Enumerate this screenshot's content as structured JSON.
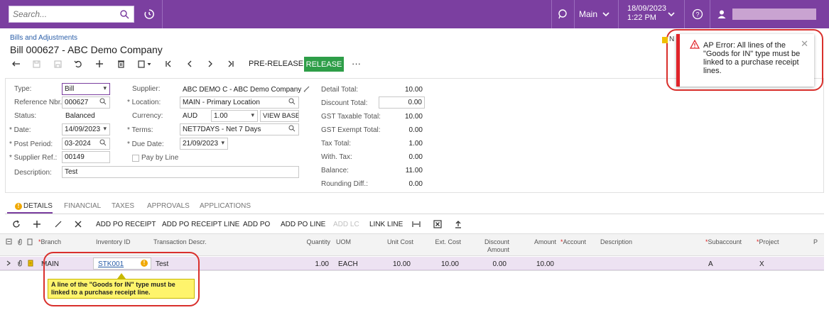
{
  "topbar": {
    "search_placeholder": "Search...",
    "company": "Main",
    "date": "18/09/2023",
    "time": "1:22 PM"
  },
  "header": {
    "breadcrumb": "Bills and Adjustments",
    "title": "Bill 000627 - ABC Demo Company"
  },
  "toolbar": {
    "pre_release": "PRE-RELEASE",
    "release": "RELEASE",
    "more": "···"
  },
  "form": {
    "type_label": "Type:",
    "type_value": "Bill",
    "refnbr_label": "Reference Nbr.:",
    "refnbr_value": "000627",
    "status_label": "Status:",
    "status_value": "Balanced",
    "date_label": "Date:",
    "date_value": "14/09/2023",
    "postperiod_label": "Post Period:",
    "postperiod_value": "03-2024",
    "supref_label": "Supplier Ref.:",
    "supref_value": "00149",
    "desc_label": "Description:",
    "desc_value": "Test",
    "supplier_label": "Supplier:",
    "supplier_value": "ABC DEMO C - ABC Demo Company",
    "location_label": "Location:",
    "location_value": "MAIN - Primary Location",
    "currency_label": "Currency:",
    "currency_code": "AUD",
    "currency_rate": "1.00",
    "view_base": "VIEW BASE",
    "terms_label": "Terms:",
    "terms_value": "NET7DAYS - Net 7 Days",
    "duedate_label": "Due Date:",
    "duedate_value": "21/09/2023",
    "paybyline_label": "Pay by Line",
    "totals": [
      {
        "label": "Detail Total:",
        "value": "10.00"
      },
      {
        "label": "Discount Total:",
        "value": "0.00"
      },
      {
        "label": "GST Taxable Total:",
        "value": "10.00"
      },
      {
        "label": "GST Exempt Total:",
        "value": "0.00"
      },
      {
        "label": "Tax Total:",
        "value": "1.00"
      },
      {
        "label": "With. Tax:",
        "value": "0.00"
      },
      {
        "label": "Balance:",
        "value": "11.00"
      },
      {
        "label": "Rounding Diff.:",
        "value": "0.00"
      }
    ]
  },
  "tabs": [
    "DETAILS",
    "FINANCIAL",
    "TAXES",
    "APPROVALS",
    "APPLICATIONS"
  ],
  "grid_toolbar": {
    "add_po_receipt": "ADD PO RECEIPT",
    "add_po_receipt_line": "ADD PO RECEIPT LINE",
    "add_po": "ADD PO",
    "add_po_line": "ADD PO LINE",
    "add_lc": "ADD LC",
    "link_line": "LINK LINE"
  },
  "grid": {
    "columns": {
      "branch": "Branch",
      "inventory_id": "Inventory ID",
      "transaction_descr": "Transaction Descr.",
      "quantity": "Quantity",
      "uom": "UOM",
      "unit_cost": "Unit Cost",
      "ext_cost": "Ext. Cost",
      "discount_amount_1": "Discount",
      "discount_amount_2": "Amount",
      "amount": "Amount",
      "account": "Account",
      "description": "Description",
      "subaccount": "Subaccount",
      "project": "Project",
      "p": "P"
    },
    "row": {
      "branch": "MAIN",
      "inventory_id": "STK001",
      "transaction_descr": "Test",
      "quantity": "1.00",
      "uom": "EACH",
      "unit_cost": "10.00",
      "ext_cost": "10.00",
      "discount_amount": "0.00",
      "amount": "10.00",
      "subaccount": "A",
      "project": "X"
    },
    "tooltip": "A line of the \"Goods for IN\" type must be linked to a purchase receipt line."
  },
  "toast": {
    "notes_label": "N",
    "message": "AP Error: All lines of the \"Goods for IN\" type must be linked to a purchase receipt lines."
  },
  "colors": {
    "topbar": "#7b3fa0",
    "release": "#2e9e48",
    "error": "#e0242a",
    "tooltip": "#fef46c"
  }
}
